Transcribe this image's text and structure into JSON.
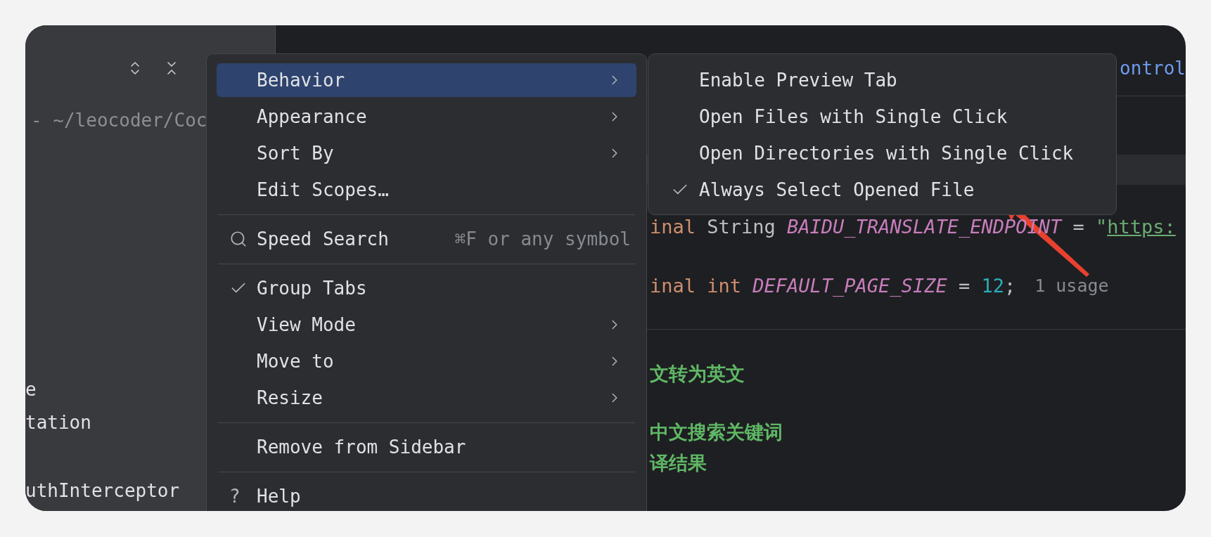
{
  "sidebar": {
    "path": "- ~/leocoder/Coc",
    "items": [
      {
        "label": "e"
      },
      {
        "label": "tation"
      },
      {
        "label": "uthInterceptor"
      }
    ]
  },
  "editor": {
    "tab_text": "ontrol",
    "lines": [
      {
        "kind": "code",
        "tokens": [
          {
            "text": "inal",
            "kind": "keyword"
          },
          {
            "text": " String ",
            "kind": "plain"
          },
          {
            "text": "BAIDU_TRANSLATE_ENDPOINT",
            "kind": "constant"
          },
          {
            "text": " = ",
            "kind": "plain"
          },
          {
            "text": "\"",
            "kind": "string"
          },
          {
            "text": "https:",
            "kind": "link"
          }
        ]
      },
      {
        "kind": "code",
        "tokens": [
          {
            "text": "inal int",
            "kind": "keyword"
          },
          {
            "text": " DEFAULT_PAGE_SIZE",
            "kind": "constant"
          },
          {
            "text": " = ",
            "kind": "plain"
          },
          {
            "text": "12",
            "kind": "number"
          },
          {
            "text": ";",
            "kind": "plain"
          }
        ],
        "hint": "1 usage"
      },
      {
        "kind": "comment",
        "text": "文转为英文"
      },
      {
        "kind": "comment",
        "text": "中文搜索关键词"
      },
      {
        "kind": "comment",
        "text": "译结果"
      }
    ]
  },
  "menu": {
    "items": [
      {
        "kind": "item",
        "label": "Behavior",
        "selected": true,
        "checked": false,
        "submenu": true
      },
      {
        "kind": "item",
        "label": "Appearance",
        "selected": false,
        "checked": false,
        "submenu": true
      },
      {
        "kind": "item",
        "label": "Sort By",
        "selected": false,
        "checked": false,
        "submenu": true
      },
      {
        "kind": "item",
        "label": "Edit Scopes…",
        "selected": false,
        "checked": false,
        "submenu": false
      },
      {
        "kind": "divider"
      },
      {
        "kind": "search",
        "label": "Speed Search",
        "selected": false,
        "checked": false,
        "submenu": false,
        "shortcut": "⌘F or any symbol"
      },
      {
        "kind": "divider"
      },
      {
        "kind": "item",
        "label": "Group Tabs",
        "selected": false,
        "checked": true,
        "submenu": false
      },
      {
        "kind": "item",
        "label": "View Mode",
        "selected": false,
        "checked": false,
        "submenu": true
      },
      {
        "kind": "item",
        "label": "Move to",
        "selected": false,
        "checked": false,
        "submenu": true
      },
      {
        "kind": "item",
        "label": "Resize",
        "selected": false,
        "checked": false,
        "submenu": true
      },
      {
        "kind": "divider"
      },
      {
        "kind": "item",
        "label": "Remove from Sidebar",
        "selected": false,
        "checked": false,
        "submenu": false
      },
      {
        "kind": "divider"
      },
      {
        "kind": "help",
        "label": "Help",
        "selected": false,
        "checked": false,
        "submenu": false,
        "glyph": "?"
      }
    ]
  },
  "submenu": {
    "items": [
      {
        "label": "Enable Preview Tab",
        "checked": false
      },
      {
        "label": "Open Files with Single Click",
        "checked": false
      },
      {
        "label": "Open Directories with Single Click",
        "checked": false
      },
      {
        "label": "Always Select Opened File",
        "checked": true
      }
    ]
  }
}
